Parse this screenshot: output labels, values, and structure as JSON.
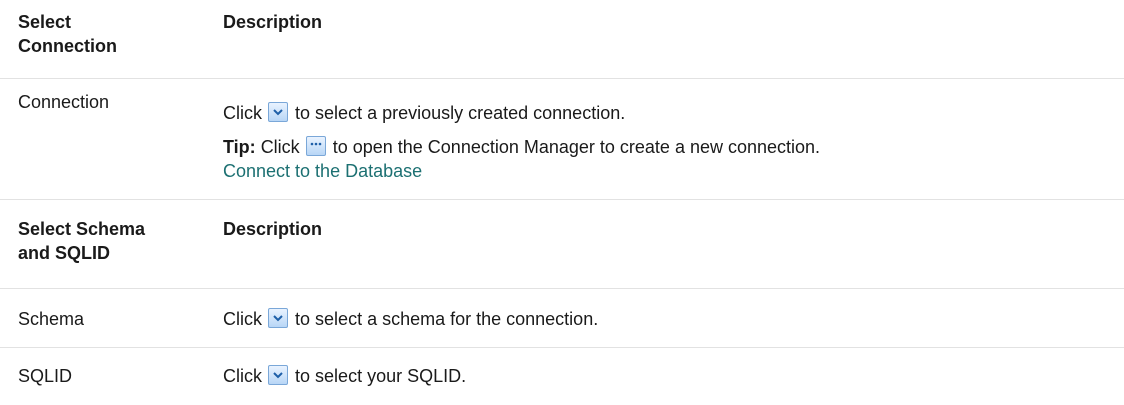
{
  "section1": {
    "header_col1_line1": "Select",
    "header_col1_line2": "Connection",
    "header_col2": "Description",
    "row": {
      "name": "Connection",
      "click_prefix": "Click",
      "click_text": "to select a previously created connection.",
      "tip_label": "Tip:",
      "tip_click": "Click",
      "tip_text": "to open the Connection Manager to create a new connection.",
      "link": "Connect to the Database"
    }
  },
  "section2": {
    "header_col1_line1": "Select Schema",
    "header_col1_line2": "and SQLID",
    "header_col2": "Description",
    "rows": [
      {
        "name": "Schema",
        "click_prefix": "Click",
        "text": "to select a schema for the connection."
      },
      {
        "name": "SQLID",
        "click_prefix": "Click",
        "text": "to select your SQLID."
      }
    ]
  },
  "icons": {
    "dropdown": "chevron-down-icon",
    "browse": "ellipsis-icon"
  },
  "colors": {
    "link": "#1c7072",
    "divider": "#e2e2e2",
    "icon_border": "#7aa7d8"
  }
}
